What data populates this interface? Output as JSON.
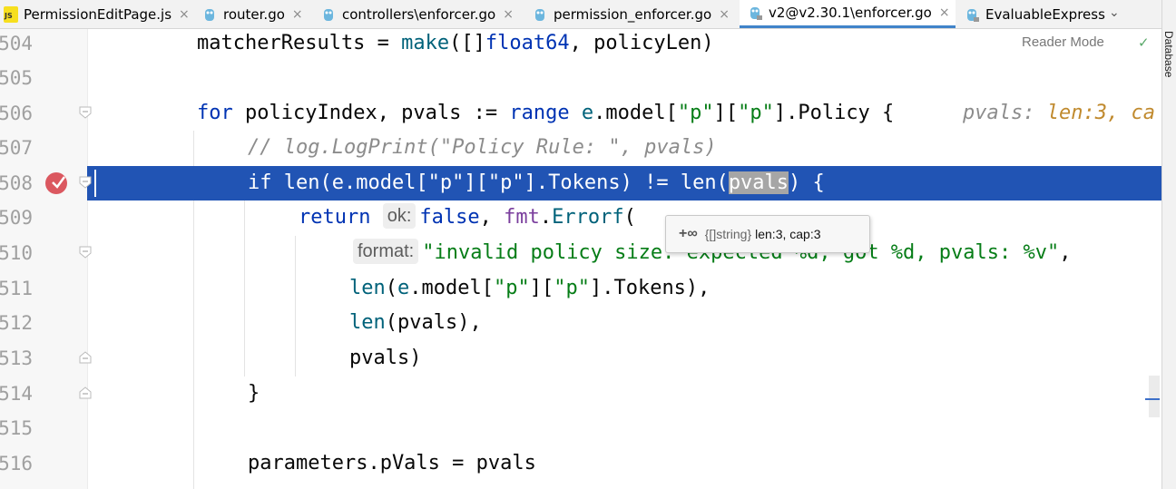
{
  "tabs": [
    {
      "label": "PermissionEditPage.js",
      "icon": "js-file-icon",
      "active": false
    },
    {
      "label": "router.go",
      "icon": "go-file-icon",
      "active": false
    },
    {
      "label": "controllers\\enforcer.go",
      "icon": "go-file-icon",
      "active": false
    },
    {
      "label": "permission_enforcer.go",
      "icon": "go-file-icon",
      "active": false
    },
    {
      "label": "v2@v2.30.1\\enforcer.go",
      "icon": "go-file-icon",
      "active": true
    },
    {
      "label": "EvaluableExpress",
      "icon": "go-file-icon",
      "active": false
    }
  ],
  "tab_close_glyph": "×",
  "tab_overflow_glyph": "⌄",
  "side_panel": {
    "label": "Database"
  },
  "editor": {
    "reader_mode": "Reader Mode",
    "line_numbers": [
      "504",
      "505",
      "506",
      "507",
      "508",
      "509",
      "510",
      "511",
      "512",
      "513",
      "514",
      "515",
      "516"
    ],
    "lines": {
      "l504": {
        "a": "matcherResults = ",
        "b": "make",
        "c": "([]",
        "d": "float64",
        "e": ", policyLen)"
      },
      "l506": {
        "a": "for",
        "b": " policyIndex, pvals := ",
        "c": "range",
        "d": " e",
        "e": ".model[",
        "f": "\"p\"",
        "g": "][",
        "h": "\"p\"",
        "i": "].Policy {",
        "inline_label": "pvals:",
        "inline_value": "len:3, ca"
      },
      "l507": {
        "a": "// log.LogPrint(\"Policy Rule: \", pvals)"
      },
      "l508": {
        "a": "if len(e.model[\"p\"][\"p\"].Tokens) != len(",
        "b": "pvals",
        "c": ") {"
      },
      "l509": {
        "a": "return",
        "hint": "ok:",
        "b": "false",
        "c": ", ",
        "d": "fmt",
        "e": ".",
        "f": "Errorf",
        "g": "("
      },
      "l510": {
        "hint": "format:",
        "a": "\"invalid policy size: expected %d, got %d, pvals: %v\"",
        "b": ","
      },
      "l511": {
        "a": "len",
        "b": "(",
        "c": "e",
        "d": ".model[",
        "e": "\"p\"",
        "f": "][",
        "g": "\"p\"",
        "h": "].Tokens),"
      },
      "l512": {
        "a": "len",
        "b": "(pvals),"
      },
      "l513": {
        "a": "pvals)"
      },
      "l514": {
        "a": "}"
      },
      "l516": {
        "a": "parameters.pVals = pvals"
      }
    }
  },
  "debug_popup": {
    "glyph": "+∞",
    "type": "{[]string}",
    "value": "len:3, cap:3"
  },
  "status_check": "✓"
}
